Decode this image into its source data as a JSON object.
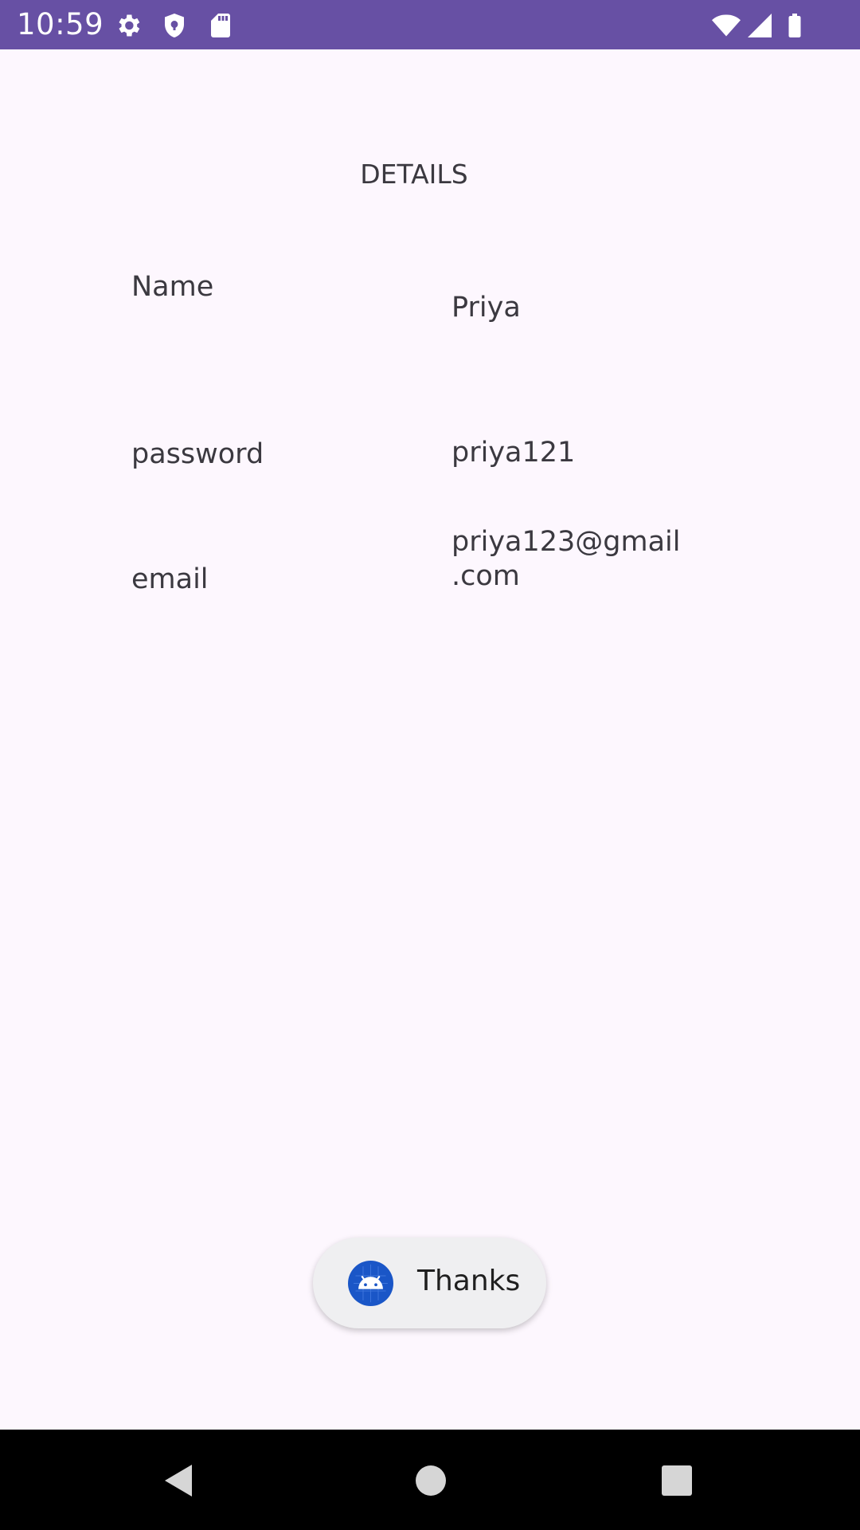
{
  "status_bar": {
    "time": "10:59",
    "left_icons": [
      "gear-icon",
      "shield-icon",
      "sd-card-icon"
    ],
    "right_icons": [
      "wifi-icon",
      "signal-icon",
      "battery-icon"
    ]
  },
  "page": {
    "title": "DETAILS",
    "fields": [
      {
        "label": "Name",
        "value": "Priya"
      },
      {
        "label": "password",
        "value": "priya121"
      },
      {
        "label": "email",
        "value": "priya123@gmail\n.com"
      }
    ]
  },
  "toast": {
    "icon": "android-icon",
    "text": "Thanks"
  },
  "nav_bar": {
    "buttons": [
      "back-icon",
      "home-icon",
      "recents-icon"
    ]
  },
  "colors": {
    "status_bar": "#6750a4",
    "background": "#fdf7fe",
    "text": "#3b3940",
    "toast_background": "#efeff1",
    "android_icon": "#1a56c7"
  }
}
